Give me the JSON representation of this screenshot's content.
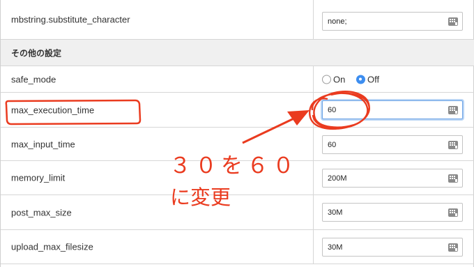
{
  "rows": [
    {
      "label": "mbstring.substitute_character",
      "value": "none;"
    },
    {
      "section": "その他の設定"
    },
    {
      "label": "safe_mode",
      "radio": {
        "on": "On",
        "off": "Off",
        "selected": "off"
      }
    },
    {
      "label": "max_execution_time",
      "value": "60"
    },
    {
      "label": "max_input_time",
      "value": "60"
    },
    {
      "label": "memory_limit",
      "value": "200M"
    },
    {
      "label": "post_max_size",
      "value": "30M"
    },
    {
      "label": "upload_max_filesize",
      "value": "30M"
    }
  ],
  "annotation": {
    "line1": "３０を６０",
    "line2": "に変更",
    "color": "#ea3b1f"
  },
  "icons": {
    "input_icon": "keyboard-icon"
  },
  "colors": {
    "focus_border": "#6ea4e6",
    "radio_checked": "#3d8ef0",
    "section_bg": "#f0f0f0"
  }
}
